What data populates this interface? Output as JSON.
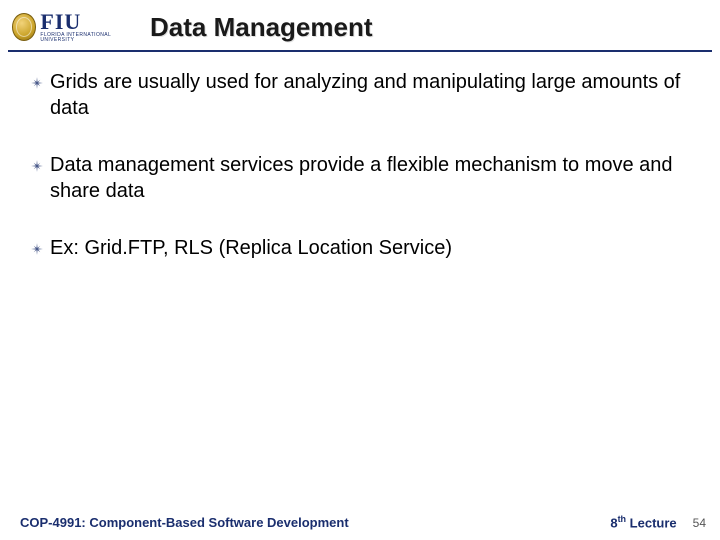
{
  "header": {
    "logo": {
      "seal": "university-seal",
      "text_big": "FIU",
      "text_small": "FLORIDA INTERNATIONAL UNIVERSITY"
    },
    "title": "Data Management"
  },
  "bullets": [
    "Grids are usually used for analyzing and manipulating large amounts of data",
    "Data management services provide a flexible mechanism to move and share data",
    "Ex: Grid.FTP, RLS (Replica Location Service)"
  ],
  "footer": {
    "course": "COP-4991: Component-Based Software Development",
    "lecture_prefix": "8",
    "lecture_suffix": "th",
    "lecture_tail": " Lecture",
    "page": "54"
  },
  "colors": {
    "accent": "#1a2e6e"
  }
}
